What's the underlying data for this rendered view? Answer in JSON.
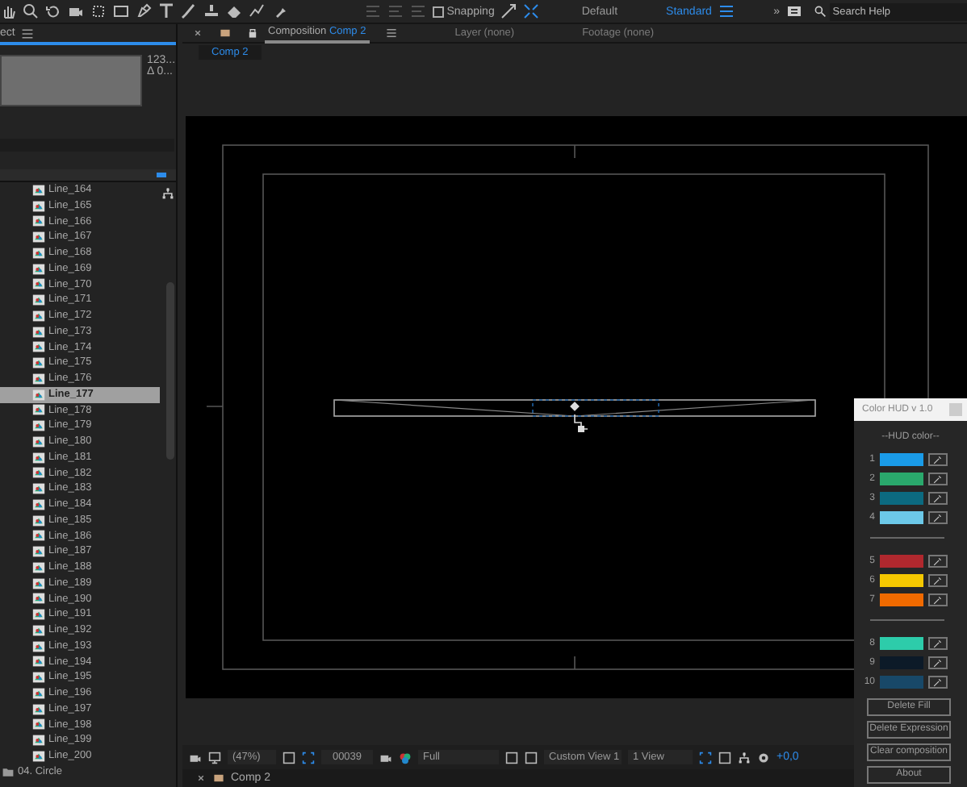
{
  "toolbar": {
    "snapping": {
      "label": "Snapping",
      "checked": false
    },
    "workspaces": [
      {
        "label": "Default",
        "selected": false
      },
      {
        "label": "Standard",
        "selected": true
      }
    ],
    "overflow": "»",
    "search": {
      "placeholder": "Search Help"
    }
  },
  "project_panel": {
    "title": "ect",
    "info": [
      "123...",
      "Δ 0..."
    ],
    "layers": [
      {
        "name": "Line_164",
        "selected": false
      },
      {
        "name": "Line_165",
        "selected": false
      },
      {
        "name": "Line_166",
        "selected": false
      },
      {
        "name": "Line_167",
        "selected": false
      },
      {
        "name": "Line_168",
        "selected": false
      },
      {
        "name": "Line_169",
        "selected": false
      },
      {
        "name": "Line_170",
        "selected": false
      },
      {
        "name": "Line_171",
        "selected": false
      },
      {
        "name": "Line_172",
        "selected": false
      },
      {
        "name": "Line_173",
        "selected": false
      },
      {
        "name": "Line_174",
        "selected": false
      },
      {
        "name": "Line_175",
        "selected": false
      },
      {
        "name": "Line_176",
        "selected": false
      },
      {
        "name": "Line_177",
        "selected": true
      },
      {
        "name": "Line_178",
        "selected": false
      },
      {
        "name": "Line_179",
        "selected": false
      },
      {
        "name": "Line_180",
        "selected": false
      },
      {
        "name": "Line_181",
        "selected": false
      },
      {
        "name": "Line_182",
        "selected": false
      },
      {
        "name": "Line_183",
        "selected": false
      },
      {
        "name": "Line_184",
        "selected": false
      },
      {
        "name": "Line_185",
        "selected": false
      },
      {
        "name": "Line_186",
        "selected": false
      },
      {
        "name": "Line_187",
        "selected": false
      },
      {
        "name": "Line_188",
        "selected": false
      },
      {
        "name": "Line_189",
        "selected": false
      },
      {
        "name": "Line_190",
        "selected": false
      },
      {
        "name": "Line_191",
        "selected": false
      },
      {
        "name": "Line_192",
        "selected": false
      },
      {
        "name": "Line_193",
        "selected": false
      },
      {
        "name": "Line_194",
        "selected": false
      },
      {
        "name": "Line_195",
        "selected": false
      },
      {
        "name": "Line_196",
        "selected": false
      },
      {
        "name": "Line_197",
        "selected": false
      },
      {
        "name": "Line_198",
        "selected": false
      },
      {
        "name": "Line_199",
        "selected": false
      },
      {
        "name": "Line_200",
        "selected": false
      }
    ],
    "folder": "04. Circle"
  },
  "composition_panel": {
    "tabs": [
      {
        "label": "Composition",
        "comp": "Comp 2",
        "selected": true
      },
      {
        "label": "Layer (none)",
        "selected": false
      },
      {
        "label": "Footage (none)",
        "selected": false
      }
    ],
    "subtab": "Comp 2",
    "viewer_toolbar": {
      "zoom": "(47%)",
      "timecode": "00039",
      "resolution": "Full",
      "view": "Custom View 1",
      "layout": "1 View",
      "exposure": "+0,0"
    }
  },
  "timeline_tab": "Comp 2",
  "color_hud": {
    "title": "Color HUD  v 1.0",
    "section": "--HUD color--",
    "groups": [
      [
        {
          "number": "1",
          "color": "#1a9be8"
        },
        {
          "number": "2",
          "color": "#2aa86c"
        },
        {
          "number": "3",
          "color": "#0c6a80"
        },
        {
          "number": "4",
          "color": "#6cc8e8"
        }
      ],
      [
        {
          "number": "5",
          "color": "#b0282e"
        },
        {
          "number": "6",
          "color": "#f5c800"
        },
        {
          "number": "7",
          "color": "#f06a00"
        }
      ],
      [
        {
          "number": "8",
          "color": "#2dccaa"
        },
        {
          "number": "9",
          "color": "#0c1a28"
        },
        {
          "number": "10",
          "color": "#184868"
        }
      ]
    ],
    "buttons": [
      "Delete Fill",
      "Delete Expression",
      "Clear composition",
      "About"
    ]
  }
}
